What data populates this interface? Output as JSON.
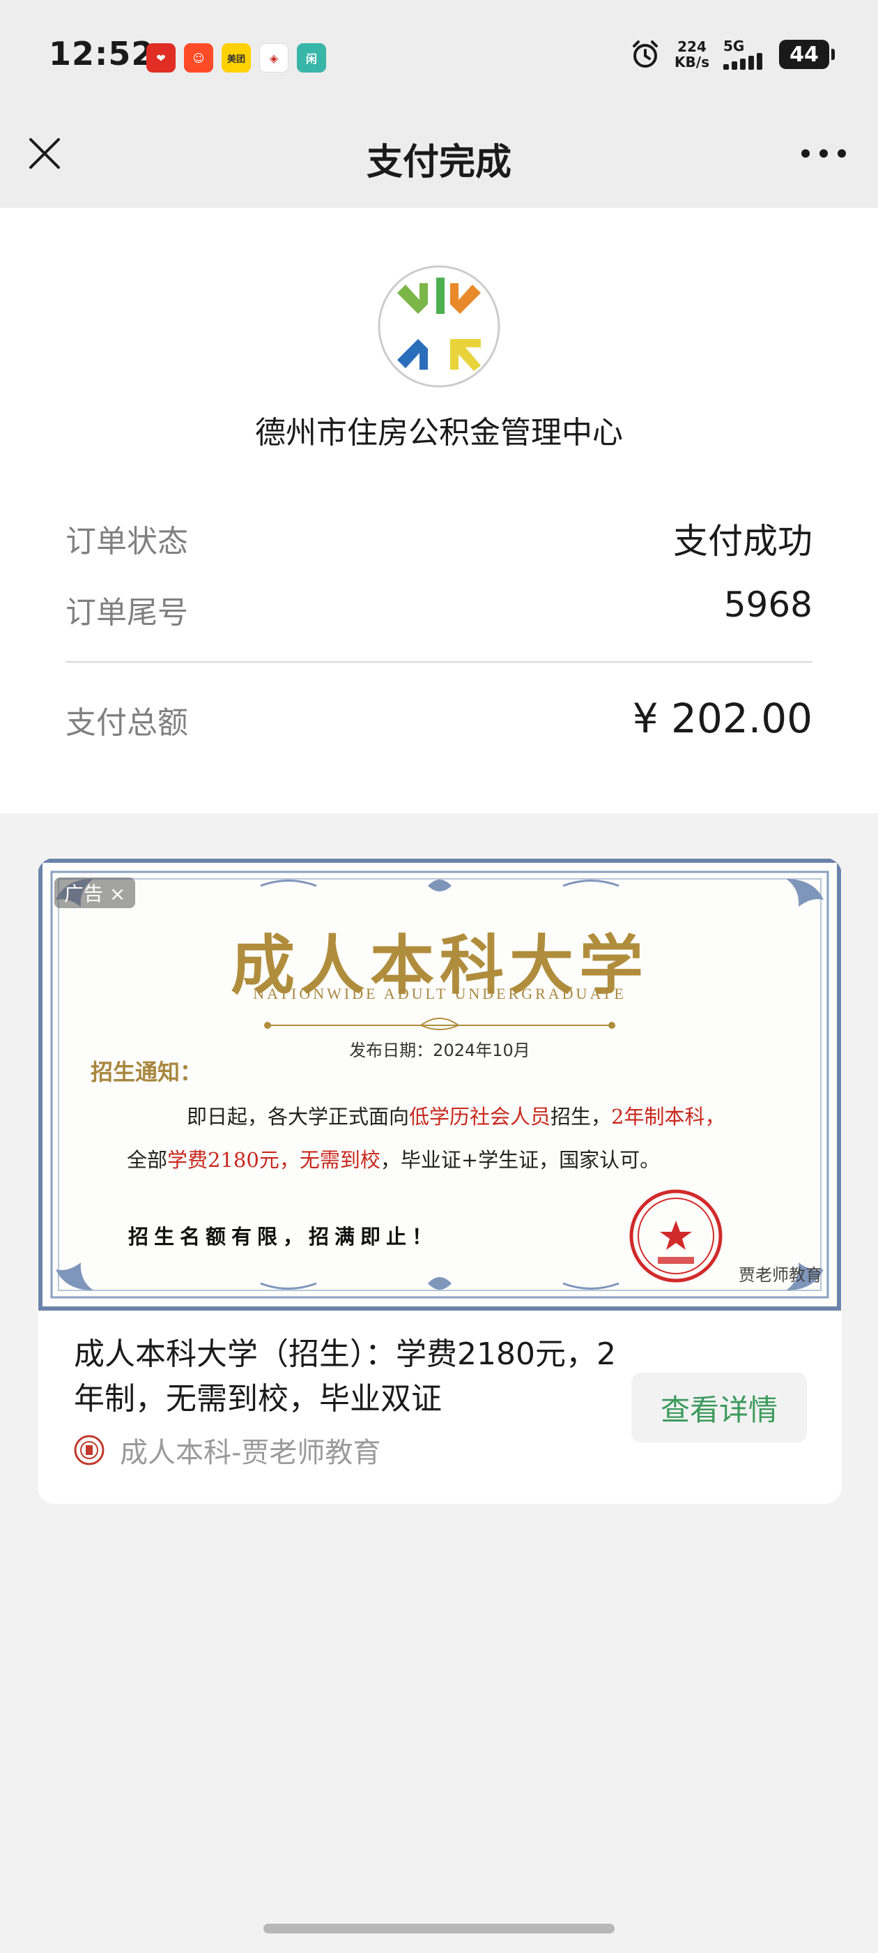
{
  "status_bar": {
    "time": "12:52",
    "apps": [
      {
        "name": "pinduoduo-icon",
        "color": "#e02e24",
        "glyph": "❤"
      },
      {
        "name": "taobao-icon",
        "color": "#ff4c28",
        "glyph": "☺"
      },
      {
        "name": "meituan-icon",
        "color": "#ffd100",
        "glyph": "美团"
      },
      {
        "name": "news-icon",
        "color": "#ffffff",
        "glyph": "◈"
      },
      {
        "name": "xianyu-icon",
        "color": "#38b6a8",
        "glyph": "闲"
      }
    ],
    "net_speed_value": "224",
    "net_speed_unit": "KB/s",
    "network": "5G",
    "battery": "44"
  },
  "nav": {
    "title": "支付完成"
  },
  "payment": {
    "merchant_name": "德州市住房公积金管理中心",
    "rows": [
      {
        "label": "订单状态",
        "value": "支付成功"
      },
      {
        "label": "订单尾号",
        "value": "5968"
      },
      {
        "label": "支付总额",
        "value": "¥ 202.00"
      }
    ]
  },
  "ad": {
    "tag": "广告 ×",
    "image": {
      "title": "成人本科大学",
      "subtitle": "NATIONWIDE ADULT UNDERGRADUATE",
      "date": "发布日期：2024年10月",
      "notice_head": "招生通知：",
      "line1_a": "即日起，各大学正式面向",
      "line1_b": "低学历社会人员",
      "line1_c": "招生，",
      "line1_d": "2年制本科，",
      "line2_a": "全部",
      "line2_b": "学费2180元，无需到校",
      "line2_c": "，毕业证+学生证，国家认可。",
      "limit": "招生名额有限，招满即止！",
      "signature": "贾老师教育"
    },
    "title": "成人本科大学（招生）：学费2180元，2年制，无需到校，毕业双证",
    "source": "成人本科-贾老师教育",
    "button": "查看详情"
  },
  "colors": {
    "accent_green": "#3b9a5c",
    "gold": "#b08d3c",
    "red": "#c8281e"
  }
}
